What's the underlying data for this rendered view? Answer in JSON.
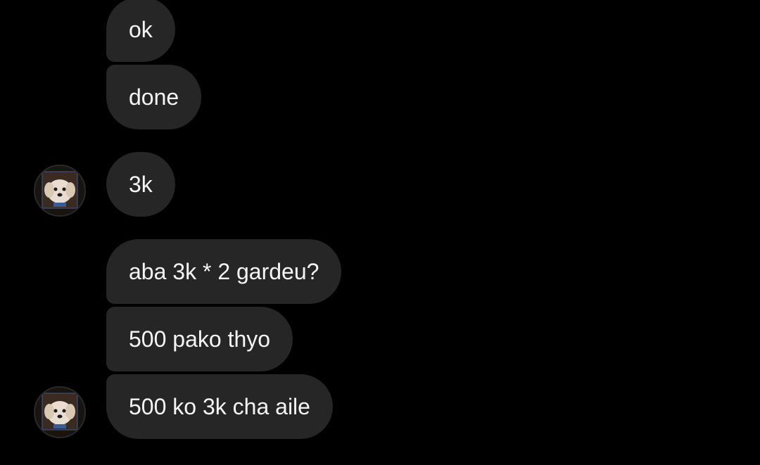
{
  "conversation": {
    "messages": [
      {
        "text": "ok"
      },
      {
        "text": "done"
      },
      {
        "text": "3k"
      },
      {
        "text": "aba 3k * 2 gardeu?"
      },
      {
        "text": "500 pako thyo"
      },
      {
        "text": "500 ko 3k cha aile"
      }
    ],
    "avatar_icon": "dog-avatar-icon"
  },
  "colors": {
    "background": "#000000",
    "bubble": "#262626",
    "text": "#f5f5f5"
  }
}
